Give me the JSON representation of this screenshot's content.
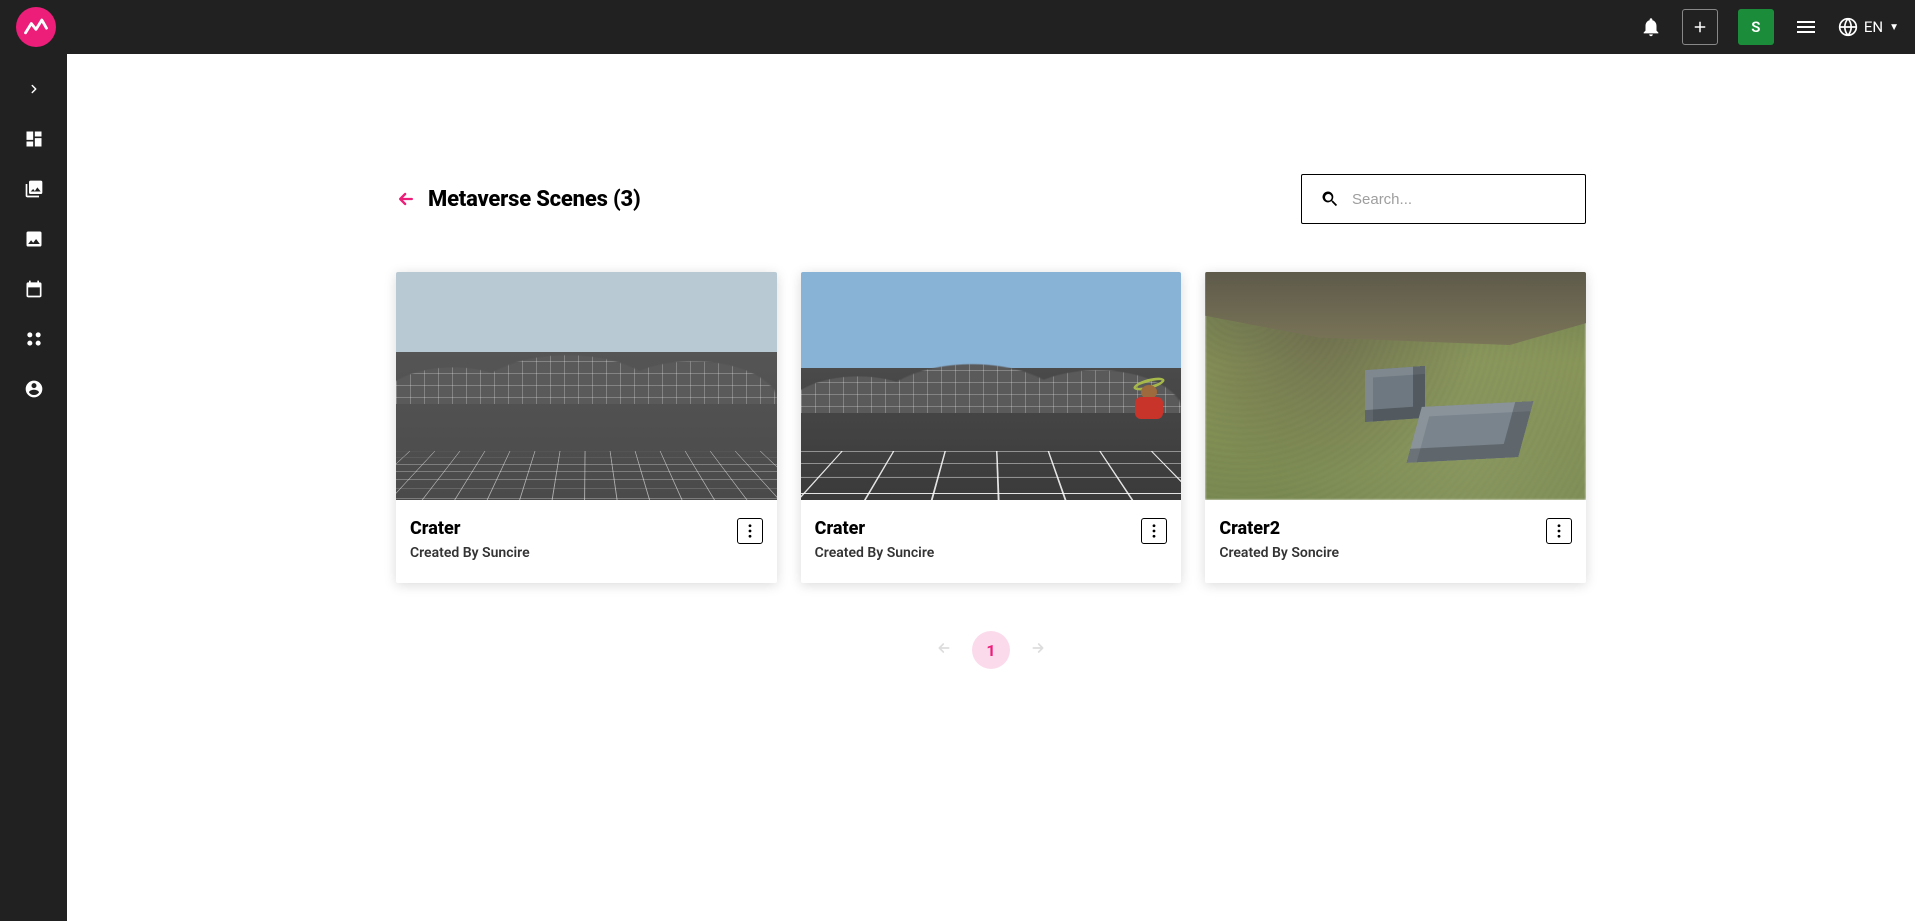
{
  "topbar": {
    "avatar_letter": "S",
    "language_label": "EN"
  },
  "page": {
    "title_prefix": "Metaverse Scenes",
    "count": "(3)",
    "search_placeholder": "Search..."
  },
  "scenes": [
    {
      "title": "Crater",
      "creator_prefix": "Created By",
      "creator": "Suncire"
    },
    {
      "title": "Crater",
      "creator_prefix": "Created By",
      "creator": "Suncire"
    },
    {
      "title": "Crater2",
      "creator_prefix": "Created By",
      "creator": "Soncire"
    }
  ],
  "pagination": {
    "current": "1"
  }
}
